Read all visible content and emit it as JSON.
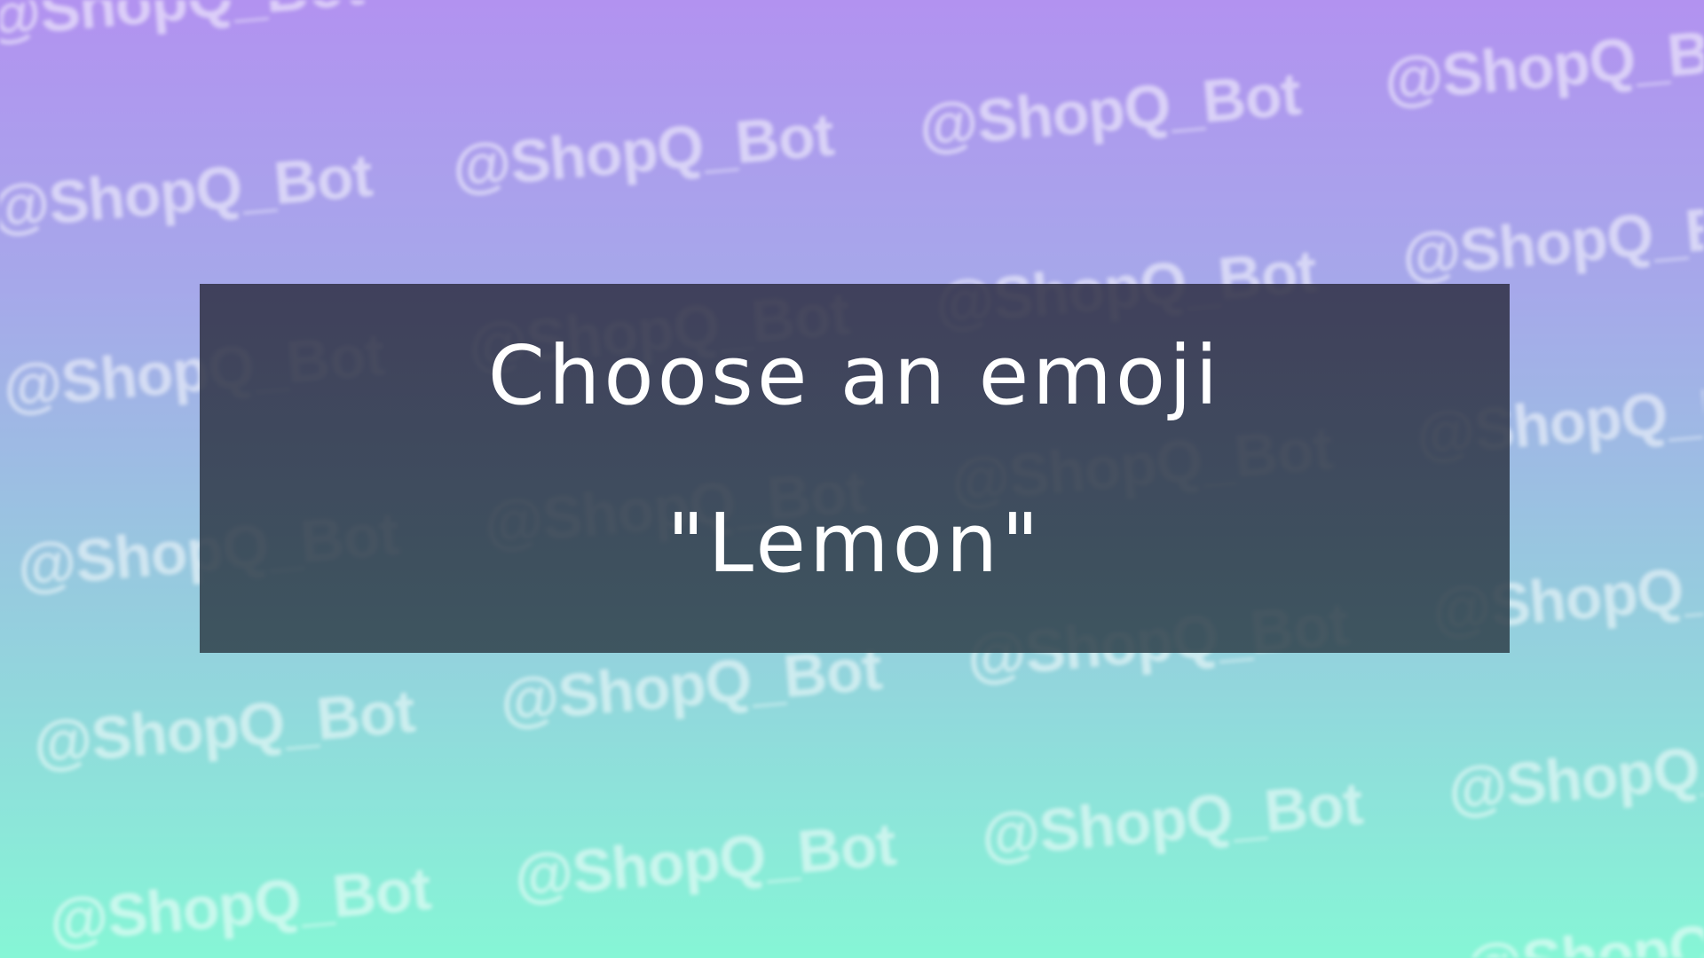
{
  "watermark": {
    "text": "@ShopQ_Bot"
  },
  "card": {
    "title": "Choose an emoji",
    "word": "\"Lemon\""
  },
  "colors": {
    "gradient_top": "#b292f0",
    "gradient_bottom": "#86f6d6",
    "card_background": "#37424e",
    "text": "#ffffff"
  }
}
